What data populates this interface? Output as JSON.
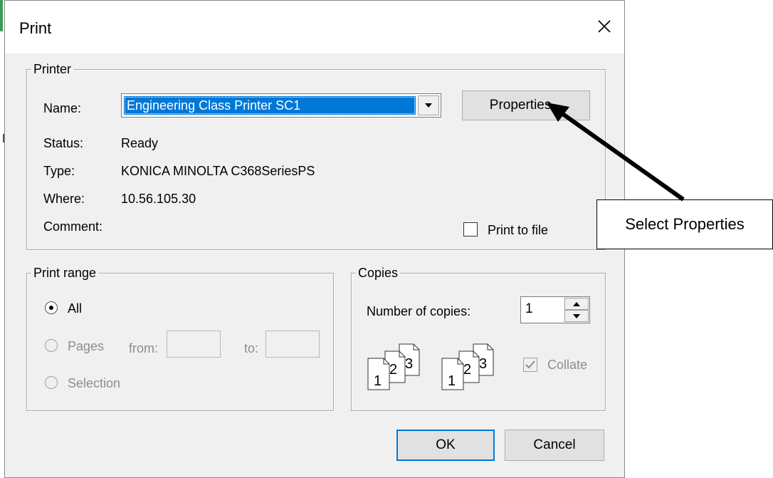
{
  "dialog": {
    "title": "Print"
  },
  "printer": {
    "legend": "Printer",
    "name_label": "Name:",
    "name_value": "Engineering Class Printer SC1",
    "properties_label": "Properties...",
    "status_label": "Status:",
    "status_value": "Ready",
    "type_label": "Type:",
    "type_value": "KONICA MINOLTA C368SeriesPS",
    "where_label": "Where:",
    "where_value": "10.56.105.30",
    "comment_label": "Comment:",
    "print_to_file_label": "Print to file"
  },
  "print_range": {
    "legend": "Print range",
    "all_label": "All",
    "pages_label": "Pages",
    "from_label": "from:",
    "to_label": "to:",
    "selection_label": "Selection"
  },
  "copies": {
    "legend": "Copies",
    "number_label": "Number of copies:",
    "number_value": "1",
    "collate_label": "Collate",
    "collate_digits": [
      "1",
      "2",
      "3"
    ]
  },
  "buttons": {
    "ok": "OK",
    "cancel": "Cancel"
  },
  "annotation": {
    "callout": "Select Properties"
  },
  "colors": {
    "selection": "#0078d7",
    "dialog_bg": "#f0f0f0",
    "disabled_text": "#8d8d8d"
  }
}
